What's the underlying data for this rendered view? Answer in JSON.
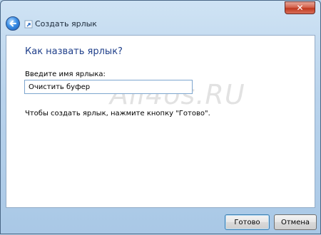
{
  "window": {
    "title": "Создать ярлык",
    "close_glyph": "✕"
  },
  "content": {
    "heading": "Как назвать ярлык?",
    "field_label": "Введите имя ярлыка:",
    "name_value": "Очистить буфер",
    "hint": "Чтобы создать ярлык, нажмите кнопку \"Готово\".",
    "watermark": "All4os.RU"
  },
  "buttons": {
    "done": "Готово",
    "cancel": "Отмена"
  },
  "colors": {
    "heading": "#1f3f8a",
    "accent": "#3c8fe6",
    "close": "#c0391f"
  },
  "icons": [
    "back-arrow-icon",
    "shortcut-wizard-icon",
    "close-icon"
  ]
}
